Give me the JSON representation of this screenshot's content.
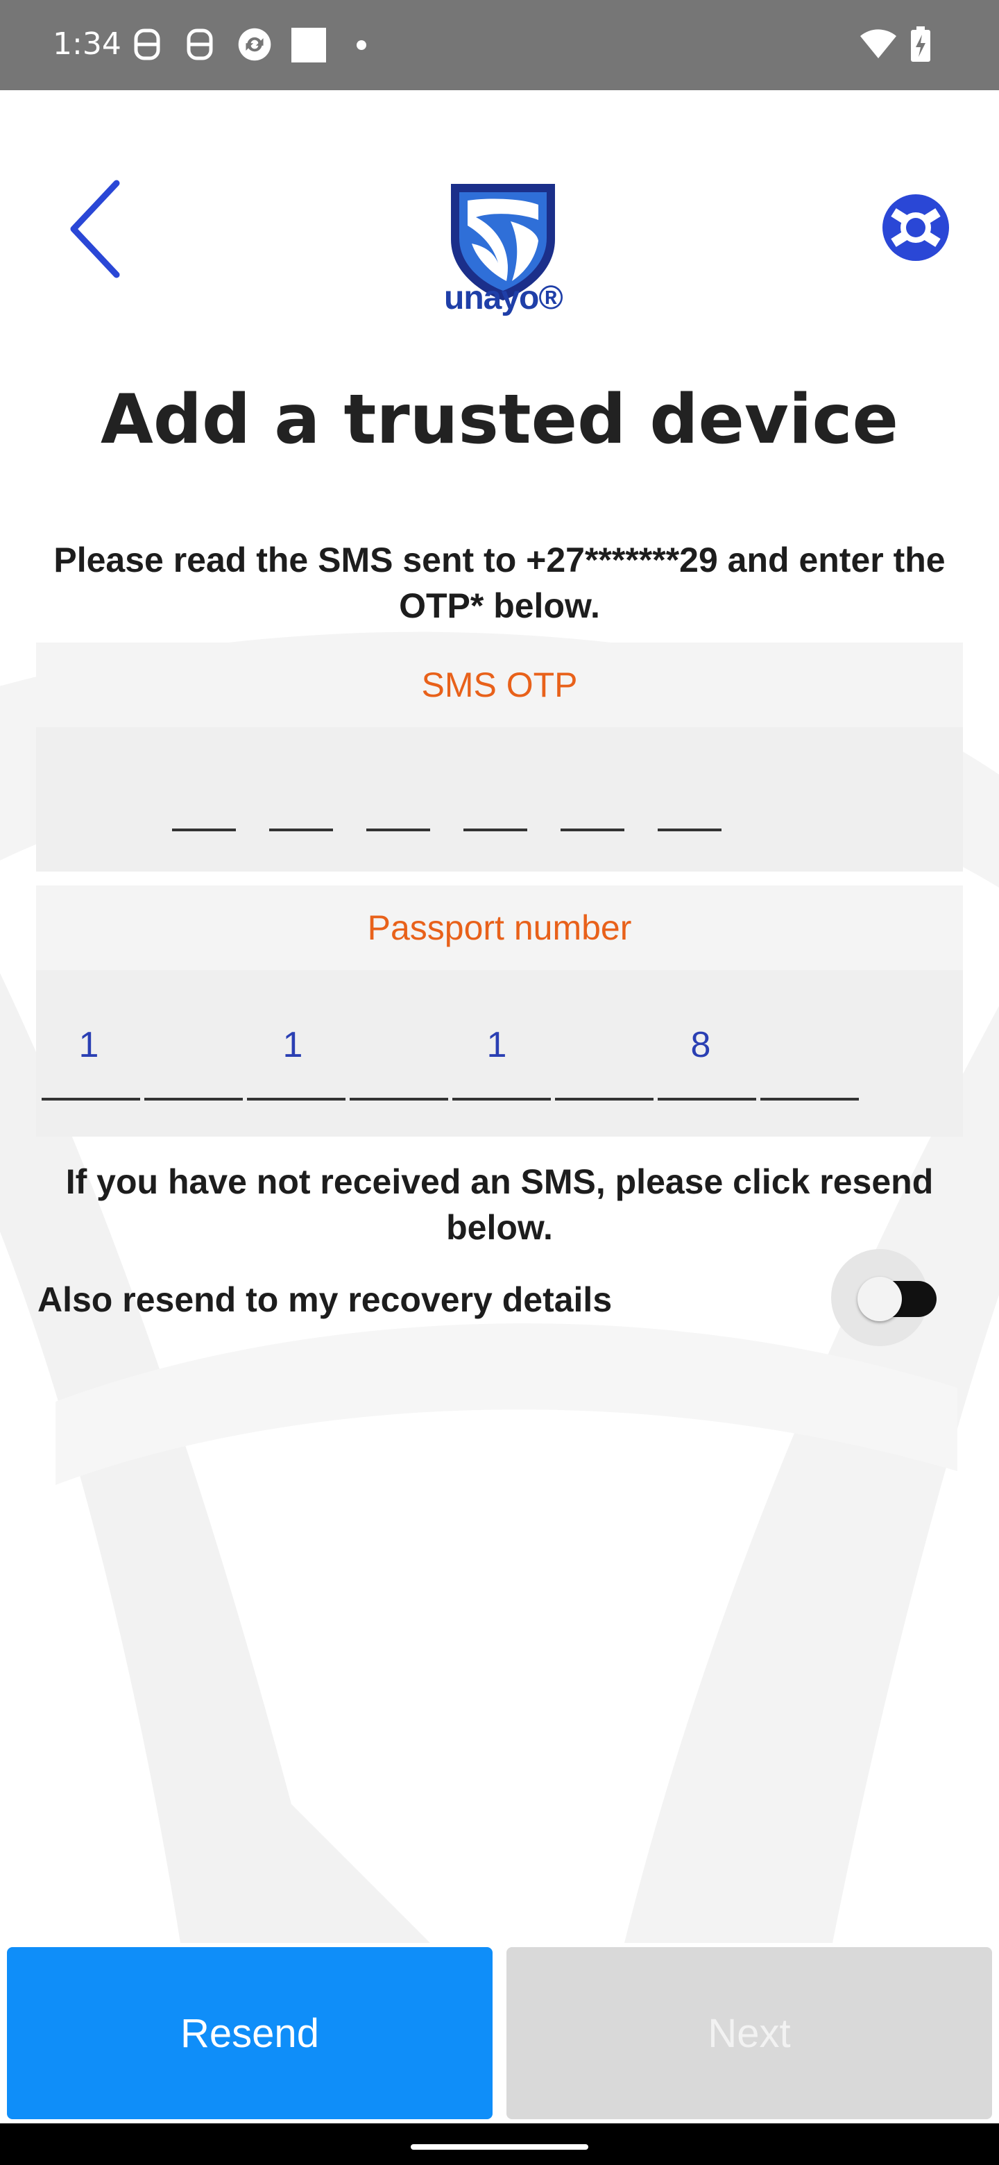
{
  "status_bar": {
    "time": "1:34",
    "icons": [
      "s-icon",
      "s-icon",
      "sync-icon",
      "square-icon",
      "dot-icon",
      "wifi-icon",
      "battery-icon"
    ]
  },
  "header": {
    "logo_text": "unayo®",
    "back_icon": "chevron-left-icon",
    "help_icon": "lifebuoy-icon"
  },
  "page": {
    "title": "Add a trusted device",
    "instructions": "Please read the SMS sent to +27*******29 and enter the OTP* below."
  },
  "otp_field": {
    "label": "SMS OTP",
    "slot_count": 6
  },
  "passport_field": {
    "label": "Passport number",
    "digits": [
      "1",
      "1",
      "1",
      "8"
    ],
    "slot_count": 8
  },
  "resend_note": "If you have not received an SMS, please click resend below.",
  "recovery_toggle": {
    "label": "Also resend to my recovery details",
    "on": false
  },
  "buttons": {
    "resend": "Resend",
    "next": "Next"
  },
  "colors": {
    "primary_button": "#0f8ef9",
    "disabled_button": "#d9d9d9",
    "field_label": "#e8611a",
    "accent_blue": "#2a3fb3"
  }
}
